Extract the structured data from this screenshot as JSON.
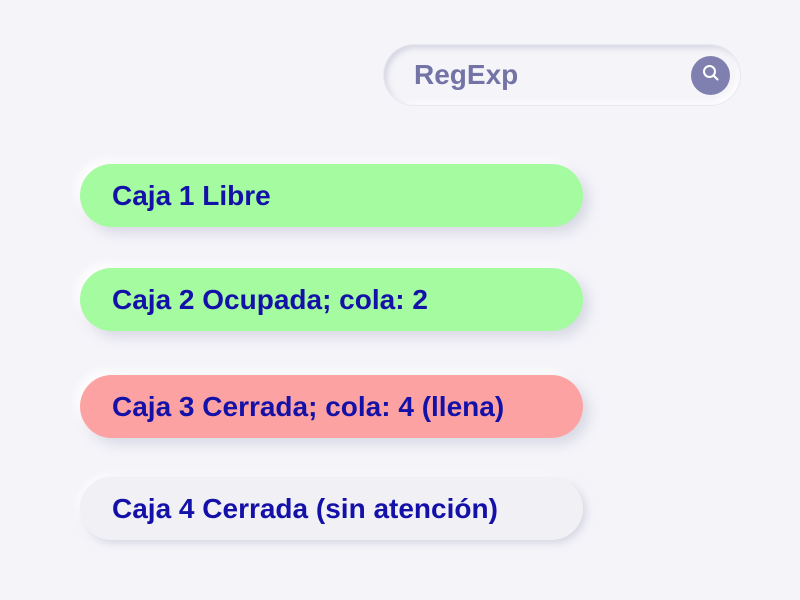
{
  "search": {
    "placeholder": "RegExp",
    "icon": "search-icon"
  },
  "boxes": [
    {
      "label": "Caja 1 Libre",
      "status": "libre",
      "color": "#a4fba0"
    },
    {
      "label": "Caja 2 Ocupada; cola: 2",
      "status": "ocupada",
      "color": "#a4fba0"
    },
    {
      "label": "Caja 3 Cerrada; cola: 4 (llena)",
      "status": "llena",
      "color": "#fda2a2"
    },
    {
      "label": "Caja 4 Cerrada (sin atención)",
      "status": "cerrada",
      "color": "#f0f0f5"
    }
  ],
  "colors": {
    "background": "#f4f4f9",
    "text": "#1411a8",
    "search_text": "#7373a6",
    "search_button": "#8080b0"
  }
}
